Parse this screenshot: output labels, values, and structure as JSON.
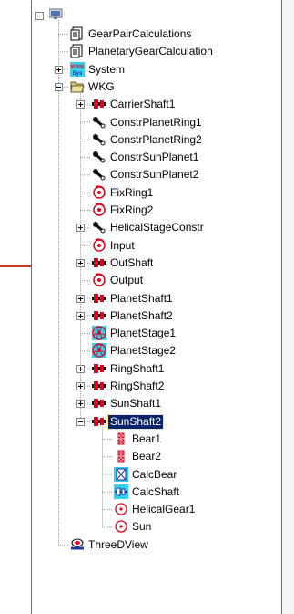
{
  "tree": {
    "root_icon": "tree-root-icon",
    "rows": [
      {
        "label": "GearPairCalculations",
        "icon": "document-icon",
        "level": 1,
        "expander": "none"
      },
      {
        "label": "PlanetaryGearCalculation",
        "icon": "document-icon",
        "level": 1,
        "expander": "none"
      },
      {
        "label": "System",
        "icon": "kiss-sys-icon",
        "level": 1,
        "expander": "plus",
        "icon_text": "KISS Sys"
      },
      {
        "label": "WKG",
        "icon": "folder-open-icon",
        "level": 1,
        "expander": "minus"
      },
      {
        "label": "CarrierShaft1",
        "icon": "shaft-icon",
        "level": 2,
        "expander": "plus"
      },
      {
        "label": "ConstrPlanetRing1",
        "icon": "constraint-icon",
        "level": 2,
        "expander": "none"
      },
      {
        "label": "ConstrPlanetRing2",
        "icon": "constraint-icon",
        "level": 2,
        "expander": "none"
      },
      {
        "label": "ConstrSunPlanet1",
        "icon": "constraint-icon",
        "level": 2,
        "expander": "none"
      },
      {
        "label": "ConstrSunPlanet2",
        "icon": "constraint-icon",
        "level": 2,
        "expander": "none"
      },
      {
        "label": "FixRing1",
        "icon": "fix-icon",
        "level": 2,
        "expander": "none"
      },
      {
        "label": "FixRing2",
        "icon": "fix-icon",
        "level": 2,
        "expander": "none"
      },
      {
        "label": "HelicalStageConstr",
        "icon": "constraint-icon",
        "level": 2,
        "expander": "plus"
      },
      {
        "label": "Input",
        "icon": "fix-icon",
        "level": 2,
        "expander": "none"
      },
      {
        "label": "OutShaft",
        "icon": "shaft-icon",
        "level": 2,
        "expander": "plus"
      },
      {
        "label": "Output",
        "icon": "fix-icon",
        "level": 2,
        "expander": "none"
      },
      {
        "label": "PlanetShaft1",
        "icon": "shaft-icon",
        "level": 2,
        "expander": "plus"
      },
      {
        "label": "PlanetShaft2",
        "icon": "shaft-icon",
        "level": 2,
        "expander": "plus"
      },
      {
        "label": "PlanetStage1",
        "icon": "planet-stage-icon",
        "level": 2,
        "expander": "none"
      },
      {
        "label": "PlanetStage2",
        "icon": "planet-stage-icon",
        "level": 2,
        "expander": "none"
      },
      {
        "label": "RingShaft1",
        "icon": "shaft-icon",
        "level": 2,
        "expander": "plus"
      },
      {
        "label": "RingShaft2",
        "icon": "shaft-icon",
        "level": 2,
        "expander": "plus"
      },
      {
        "label": "SunShaft1",
        "icon": "shaft-icon",
        "level": 2,
        "expander": "plus"
      },
      {
        "label": "SunShaft2",
        "icon": "shaft-icon",
        "level": 2,
        "expander": "minus",
        "selected": true
      },
      {
        "label": "Bear1",
        "icon": "bearing-icon",
        "level": 3,
        "expander": "none"
      },
      {
        "label": "Bear2",
        "icon": "bearing-icon",
        "level": 3,
        "expander": "none"
      },
      {
        "label": "CalcBear",
        "icon": "calc-bearing-icon",
        "level": 3,
        "expander": "none"
      },
      {
        "label": "CalcShaft",
        "icon": "calc-shaft-icon",
        "level": 3,
        "expander": "none"
      },
      {
        "label": "HelicalGear1",
        "icon": "gear-icon",
        "level": 3,
        "expander": "none"
      },
      {
        "label": "Sun",
        "icon": "gear-icon",
        "level": 3,
        "expander": "none"
      },
      {
        "label": "ThreeDView",
        "icon": "three-d-view-icon",
        "level": 1,
        "expander": "none"
      }
    ]
  },
  "colors": {
    "selection_bg": "#0a246a",
    "selection_text": "#ffffff",
    "shaft_red": "#e3001b",
    "icon_cyan": "#33d0f0",
    "marker_red": "#c0392b"
  }
}
